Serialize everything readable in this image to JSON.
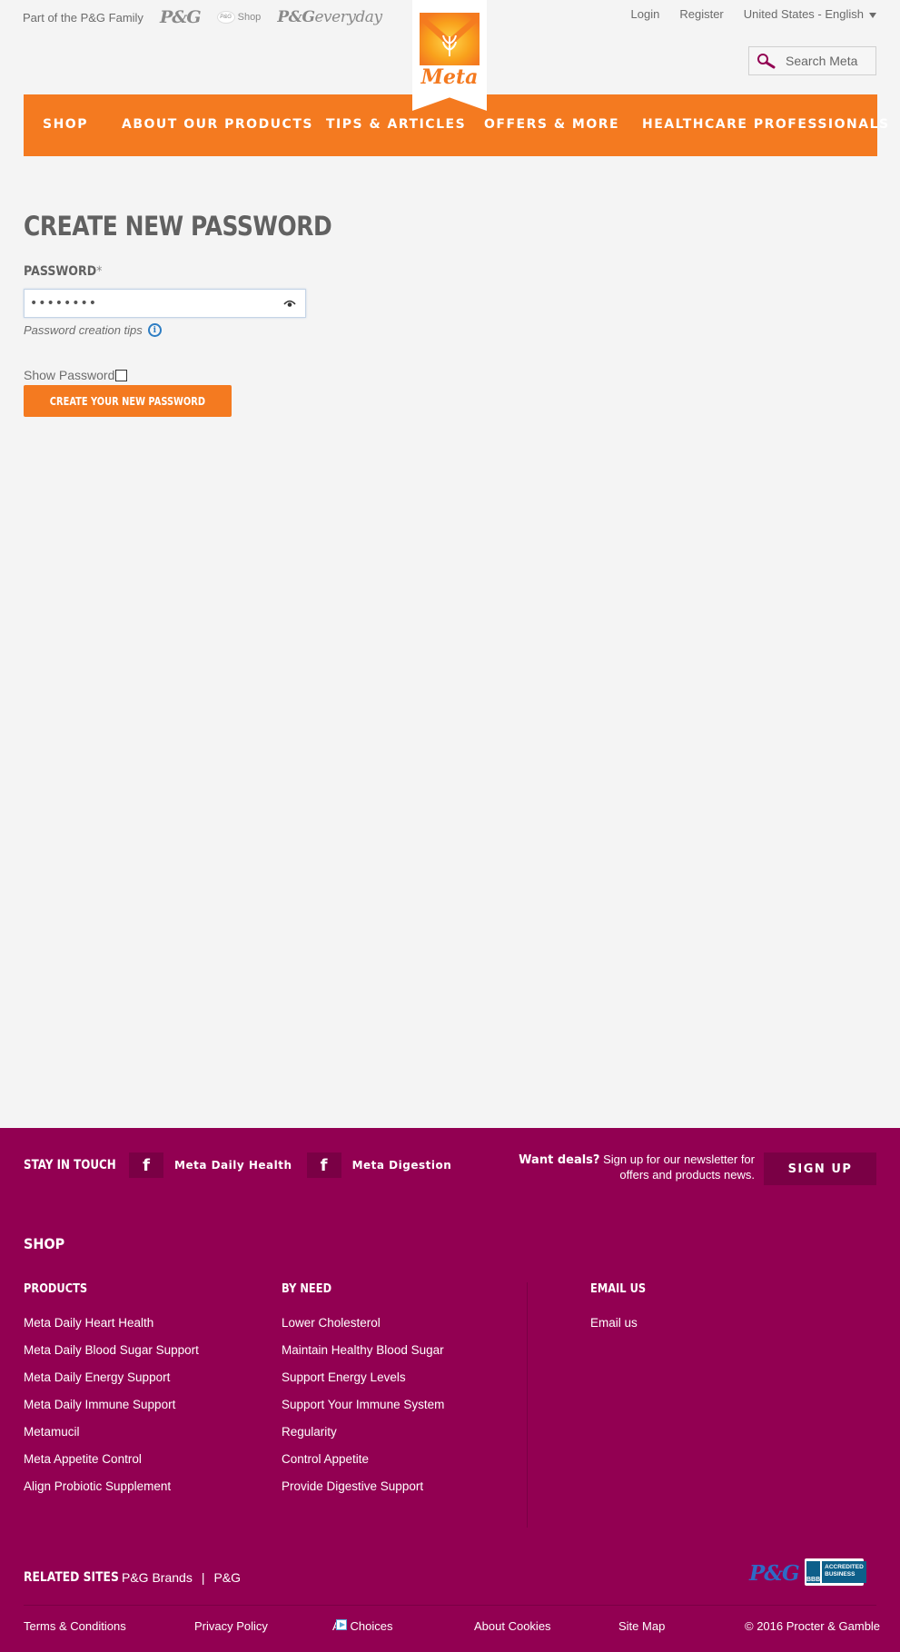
{
  "topbar": {
    "family_text": "Part of the P&G Family",
    "pg_logo": "P&G",
    "pg_shop_badge": "P&G",
    "pg_shop": "Shop",
    "pg_everyday_bold": "P&G",
    "pg_everyday": "everyday",
    "login": "Login",
    "register": "Register",
    "locale": "United States - English"
  },
  "brand": {
    "logo_text": "Meta",
    "colors": {
      "orange": "#f47a20",
      "footer": "#920052"
    }
  },
  "search": {
    "placeholder": "Search Meta",
    "icon": "search-icon"
  },
  "nav": {
    "items": [
      {
        "label": "Shop"
      },
      {
        "label": "About Our Products"
      },
      {
        "label": "Tips & Articles"
      },
      {
        "label": "Offers & More"
      },
      {
        "label": "Healthcare Professionals"
      }
    ]
  },
  "form": {
    "title": "CREATE NEW PASSWORD",
    "password_label": "PASSWORD",
    "required_mark": "*",
    "password_value": "••••••••",
    "tips": "Password creation tips",
    "show_password": "Show Password",
    "show_password_checked": false,
    "submit": "Create your new password"
  },
  "footer": {
    "stay_in_touch": "STAY IN TOUCH",
    "facebook_1": "Meta Daily Health",
    "facebook_2": "Meta Digestion",
    "deals_bold": "Want deals?",
    "deals_text": "Sign up for our newsletter for offers and products news.",
    "signup": "SIGN UP",
    "shop_heading": "SHOP",
    "products": {
      "heading": "PRODUCTS",
      "items": [
        "Meta Daily Heart Health",
        "Meta Daily Blood Sugar Support",
        "Meta Daily Energy Support",
        "Meta Daily Immune Support",
        "Metamucil",
        "Meta Appetite Control",
        "Align Probiotic Supplement"
      ]
    },
    "by_need": {
      "heading": "BY NEED",
      "items": [
        "Lower Cholesterol",
        "Maintain Healthy Blood Sugar",
        "Support Energy Levels",
        "Support Your Immune System",
        "Regularity",
        "Control Appetite",
        "Provide Digestive Support"
      ]
    },
    "email": {
      "heading": "EMAIL US",
      "link": "Email us"
    },
    "related": {
      "heading": "RELATED SITES",
      "links": [
        "P&G Brands",
        "P&G"
      ],
      "separator": "|"
    },
    "pg_logo": "P&G",
    "bbb_seal": "BBB",
    "bbb_text": "ACCREDITED BUSINESS",
    "bottom": {
      "terms": "Terms & Conditions",
      "privacy": "Privacy Policy",
      "ad_choices": "Ad Choices",
      "cookies": "About Cookies",
      "sitemap": "Site Map",
      "copyright": "© 2016 Procter & Gamble"
    }
  }
}
